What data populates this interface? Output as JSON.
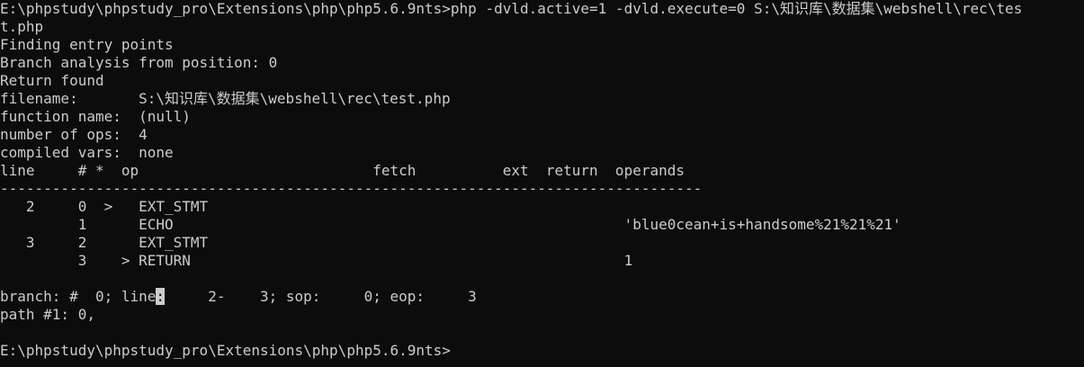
{
  "terminal": {
    "lines": [
      "E:\\phpstudy\\phpstudy_pro\\Extensions\\php\\php5.6.9nts>php -dvld.active=1 -dvld.execute=0 S:\\知识库\\数据集\\webshell\\rec\\tes",
      "t.php",
      "Finding entry points",
      "Branch analysis from position: 0",
      "Return found",
      "filename:       S:\\知识库\\数据集\\webshell\\rec\\test.php",
      "function name:  (null)",
      "number of ops:  4",
      "compiled vars:  none",
      "line     # *  op                           fetch          ext  return  operands",
      "---------------------------------------------------------------------------------",
      "   2     0  >   EXT_STMT",
      "         1      ECHO                                                    'blue0cean+is+handsome%21%21%21'",
      "   3     2      EXT_STMT",
      "         3    > RETURN                                                  1",
      "",
      "path #1: 0,",
      "",
      "E:\\phpstudy\\phpstudy_pro\\Extensions\\php\\php5.6.9nts>"
    ],
    "branch_line": {
      "before_cursor": "branch: #  0; line",
      "cursor_char": ":",
      "after_cursor": "     2-    3; sop:     0; eop:     3"
    }
  }
}
